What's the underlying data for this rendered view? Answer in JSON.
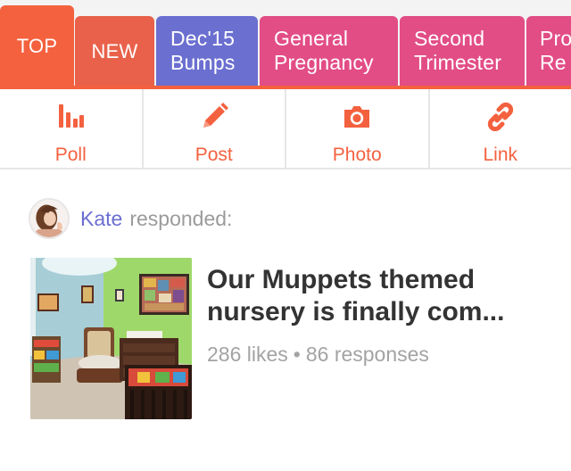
{
  "tabs": [
    {
      "label": "TOP"
    },
    {
      "label": "NEW"
    },
    {
      "line1": "Dec'15",
      "line2": "Bumps"
    },
    {
      "line1": "General",
      "line2": "Pregnancy"
    },
    {
      "line1": "Second",
      "line2": "Trimester"
    },
    {
      "line1": "Pro",
      "line2": "Re"
    }
  ],
  "actions": [
    {
      "label": "Poll",
      "icon": "bar-chart-icon"
    },
    {
      "label": "Post",
      "icon": "pencil-icon"
    },
    {
      "label": "Photo",
      "icon": "camera-icon"
    },
    {
      "label": "Link",
      "icon": "link-icon"
    }
  ],
  "feed_item": {
    "responder_name": "Kate",
    "responder_verb": "responded:",
    "title": "Our Muppets themed nursery is finally com...",
    "likes": "286 likes",
    "separator": "•",
    "responses": "86 responses"
  },
  "colors": {
    "accent": "#f4613f",
    "tab_new": "#e9614a",
    "tab_due_date": "#6b6fd0",
    "tab_group": "#e24d86",
    "username": "#6b6fd0",
    "meta_text": "#a3a3a3",
    "title_text": "#333333"
  }
}
